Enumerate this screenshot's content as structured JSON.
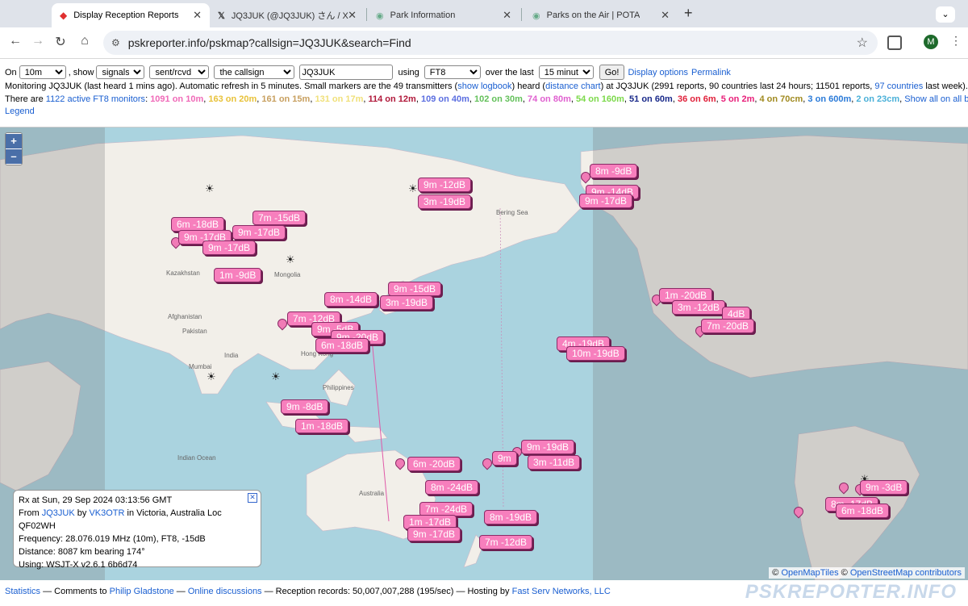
{
  "tabs": [
    {
      "title": "Display Reception Reports",
      "active": true
    },
    {
      "title": "JQ3JUK (@JQ3JUK) さん / X",
      "active": false
    },
    {
      "title": "Park Information",
      "active": false
    },
    {
      "title": "Parks on the Air | POTA",
      "active": false
    }
  ],
  "address": {
    "url": "pskreporter.info/pskmap?callsign=JQ3JUK&search=Find"
  },
  "profile": {
    "initial": "M"
  },
  "controls": {
    "on_label": "On",
    "band": "10m",
    "show_label": ", show",
    "show": "signals",
    "direction": "sent/rcvd by",
    "target": "the callsign",
    "callsign": "JQ3JUK",
    "using_label": "using",
    "mode": "FT8",
    "over_label": "over the last",
    "period": "15 minutes",
    "go": "Go!",
    "display_options": "Display options",
    "permalink": "Permalink"
  },
  "status": {
    "p1": "Monitoring JQ3JUK (last heard 1 mins ago). Automatic refresh in 5 minutes. Small markers are the 49 transmitters (",
    "show_logbook": "show logbook",
    "p2": ") heard (",
    "distance_chart": "distance chart",
    "p3": ") at JQ3JUK (2991 reports, 90 countries last 24 hours; 11501 reports,",
    "countries_link": "97 countries",
    "p4": "last week)."
  },
  "monitors": {
    "prefix": "There are",
    "active_link": "1122 active FT8 monitors",
    "bands": [
      {
        "text": "1091 on 10m",
        "color": "#f06ab8"
      },
      {
        "text": "163 on 20m",
        "color": "#e8c23a"
      },
      {
        "text": "161 on 15m",
        "color": "#c8a060"
      },
      {
        "text": "131 on 17m",
        "color": "#f0e07a"
      },
      {
        "text": "114 on 12m",
        "color": "#b0183a"
      },
      {
        "text": "109 on 40m",
        "color": "#5b6ee0"
      },
      {
        "text": "102 on 30m",
        "color": "#63c05a"
      },
      {
        "text": "74 on 80m",
        "color": "#e060d0"
      },
      {
        "text": "54 on 160m",
        "color": "#7cd94a"
      },
      {
        "text": "51 on 60m",
        "color": "#1a2a8a"
      },
      {
        "text": "36 on 6m",
        "color": "#e0203a"
      },
      {
        "text": "5 on 2m",
        "color": "#e8207a"
      },
      {
        "text": "4 on 70cm",
        "color": "#a08a20"
      },
      {
        "text": "3 on 600m",
        "color": "#2a7ad8"
      },
      {
        "text": "2 on 23cm",
        "color": "#4ab0d8"
      }
    ],
    "show_all": "Show all on all bands.",
    "legend": "Legend"
  },
  "map": {
    "zoom_in": "+",
    "zoom_out": "–",
    "labels": [
      "8m -9dB",
      "9m -14dB",
      "9m -17dB",
      "9m -12dB",
      "3m -19dB",
      "6m -18dB",
      "7m -15dB",
      "9m -17dB",
      "9m -17dB",
      "9m -17dB",
      "1m -9dB",
      "9m -15dB",
      "8m -14dB",
      "3m -19dB",
      "7m -12dB",
      "9m -5dB",
      "9m -20dB",
      "6m -18dB",
      "4m -19dB",
      "10m -19dB",
      "1m -20dB",
      "3m -12dB",
      "4dB",
      "7m -20dB",
      "9m -8dB",
      "1m -18dB",
      "9m -19dB",
      "9m",
      "3m -11dB",
      "6m -20dB",
      "8m -24dB",
      "7m -24dB",
      "1m -17dB",
      "9m -17dB",
      "8m -19dB",
      "7m -12dB",
      "9m -3dB",
      "8m -17dB",
      "6m -18dB"
    ],
    "place_names": [
      "Bering Sea",
      "Kazakhstan",
      "Mongolia",
      "Afghanistan",
      "Pakistan",
      "India",
      "Mumbai",
      "Philippines",
      "Hong Kong",
      "Indian Ocean",
      "Australia"
    ],
    "attribution_prefix": "©",
    "attribution_tiles": "OpenMapTiles",
    "attribution_osm": "OpenStreetMap contributors",
    "attribution_sep": "©"
  },
  "infobox": {
    "line1": "Rx at Sun, 29 Sep 2024 03:13:56 GMT",
    "from_label": "From",
    "rx_call": "JQ3JUK",
    "by_label": "by",
    "tx_call": "VK3OTR",
    "location": "in Victoria, Australia Loc QF02WH",
    "line3": "Frequency: 28.076.019 MHz (10m), FT8, -15dB",
    "line4": "Distance: 8087 km bearing 174°",
    "line5": "Using: WSJT-X v2.6.1 6b6d74"
  },
  "footer": {
    "statistics": "Statistics",
    "comments": "— Comments to",
    "author": "Philip Gladstone",
    "dash1": "—",
    "discussions": "Online discussions",
    "records": "— Reception records: 50,007,007,288 (195/sec) — Hosting by",
    "hosting": "Fast Serv Networks, LLC",
    "brand": "PSKREPORTER.INFO"
  }
}
